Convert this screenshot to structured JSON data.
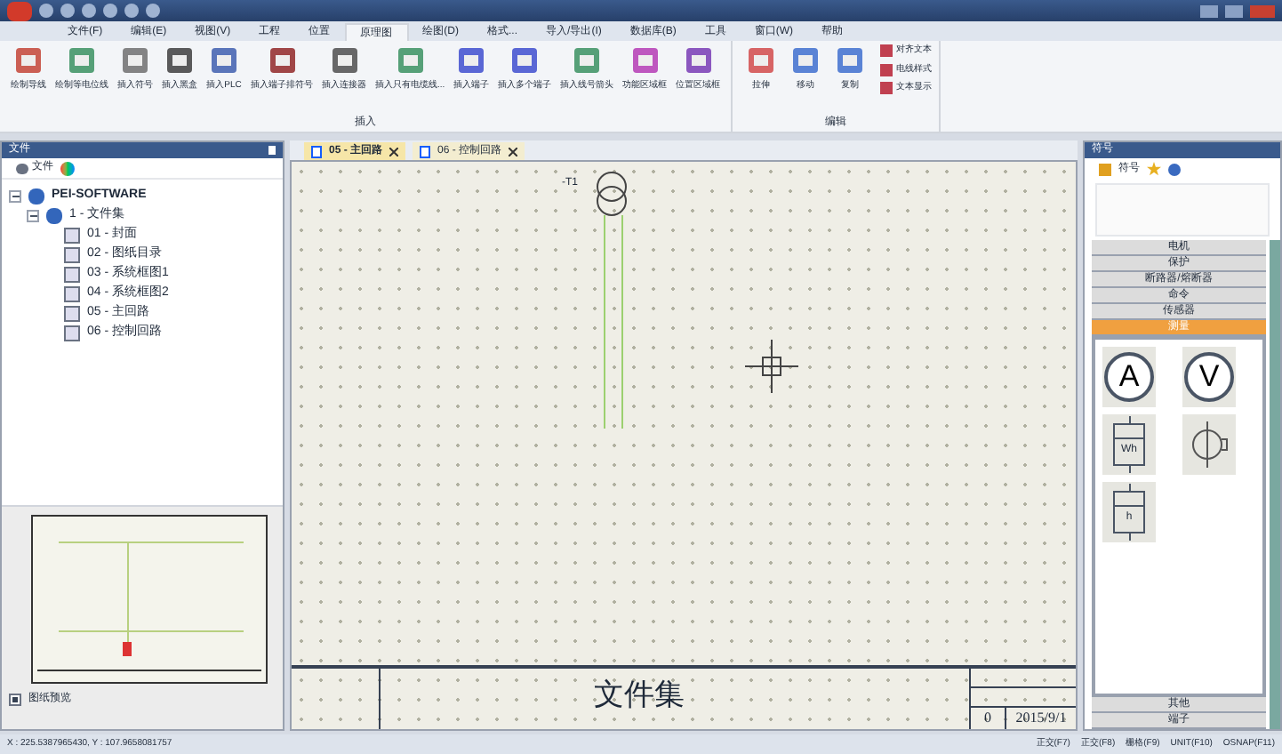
{
  "menu": [
    {
      "label": "文件(F)",
      "selected": false
    },
    {
      "label": "编辑(E)",
      "selected": false
    },
    {
      "label": "视图(V)",
      "selected": false
    },
    {
      "label": "工程",
      "selected": false
    },
    {
      "label": "位置",
      "selected": false
    },
    {
      "label": "原理图",
      "selected": true
    },
    {
      "label": "绘图(D)",
      "selected": false
    },
    {
      "label": "格式...",
      "selected": false
    },
    {
      "label": "导入/导出(I)",
      "selected": false
    },
    {
      "label": "数据库(B)",
      "selected": false
    },
    {
      "label": "工具",
      "selected": false
    },
    {
      "label": "窗口(W)",
      "selected": false
    },
    {
      "label": "帮助",
      "selected": false
    }
  ],
  "ribbon": {
    "groups": [
      {
        "label": "插入",
        "buttons": [
          {
            "kind": "wire",
            "label": "绘制导线"
          },
          {
            "kind": "potential",
            "label": "绘制等电位线"
          },
          {
            "kind": "symbol",
            "label": "插入符号"
          },
          {
            "kind": "blackbox",
            "label": "插入黑盒"
          },
          {
            "kind": "plc",
            "label": "插入PLC"
          },
          {
            "kind": "grid",
            "label": "插入端子排符号"
          },
          {
            "kind": "connector",
            "label": "插入连接器"
          },
          {
            "kind": "cable",
            "label": "插入只有电缆线..."
          },
          {
            "kind": "terminal",
            "label": "插入端子"
          },
          {
            "kind": "terminals",
            "label": "插入多个端子"
          },
          {
            "kind": "arrow",
            "label": "插入线号箭头"
          },
          {
            "kind": "func",
            "label": "功能区域框"
          },
          {
            "kind": "pos",
            "label": "位置区域框"
          }
        ]
      },
      {
        "label": "编辑",
        "buttons": [
          {
            "kind": "stretch",
            "label": "拉伸"
          },
          {
            "kind": "move",
            "label": "移动"
          },
          {
            "kind": "copy",
            "label": "复制"
          }
        ],
        "small_buttons": [
          "对齐文本",
          "电线样式",
          "文本显示"
        ]
      }
    ]
  },
  "file_panel": {
    "title": "文件",
    "tab": "文件",
    "tree": {
      "label": "PEI-SOFTWARE",
      "expanded": true,
      "children": [
        {
          "label": "1 - 文件集",
          "expanded": true,
          "children": [
            {
              "label": "01 - 封面"
            },
            {
              "label": "02 - 图纸目录"
            },
            {
              "label": "03 - 系统框图1"
            },
            {
              "label": "04 - 系统框图2"
            },
            {
              "label": "05 - 主回路"
            },
            {
              "label": "06 - 控制回路"
            }
          ]
        }
      ]
    }
  },
  "preview": {
    "checkbox": {
      "label": "图纸预览",
      "checked": true
    }
  },
  "tabs": [
    {
      "label": "05 - 主回路",
      "selected": true
    },
    {
      "label": "06 - 控制回路",
      "selected": false
    }
  ],
  "canvas": {
    "component_label": "-T1",
    "title_block": {
      "title": "文件集",
      "revision": "0",
      "date": "2015/9/1"
    }
  },
  "symbols_panel": {
    "title": "符号",
    "tab": "符号",
    "categories": [
      {
        "label": "电机",
        "selected": false
      },
      {
        "label": "保护",
        "selected": false
      },
      {
        "label": "断路器/熔断器",
        "selected": false
      },
      {
        "label": "命令",
        "selected": false
      },
      {
        "label": "传感器",
        "selected": false
      },
      {
        "label": "测量",
        "selected": true
      }
    ],
    "symbols": [
      {
        "kind": "circle",
        "letter": "A"
      },
      {
        "kind": "circle",
        "letter": "V"
      },
      {
        "kind": "meter",
        "letter": "Wh"
      },
      {
        "kind": "phase"
      },
      {
        "kind": "meter",
        "letter": "h"
      }
    ],
    "bottom_categories": [
      {
        "label": "其他",
        "selected": false
      },
      {
        "label": "端子",
        "selected": false
      }
    ]
  },
  "status_bar": {
    "coords": "X : 225.5387965430, Y : 107.9658081757",
    "toggles": [
      "正交(F7)",
      "正交(F8)",
      "栅格(F9)",
      "UNIT(F10)",
      "OSNAP(F11)"
    ]
  }
}
